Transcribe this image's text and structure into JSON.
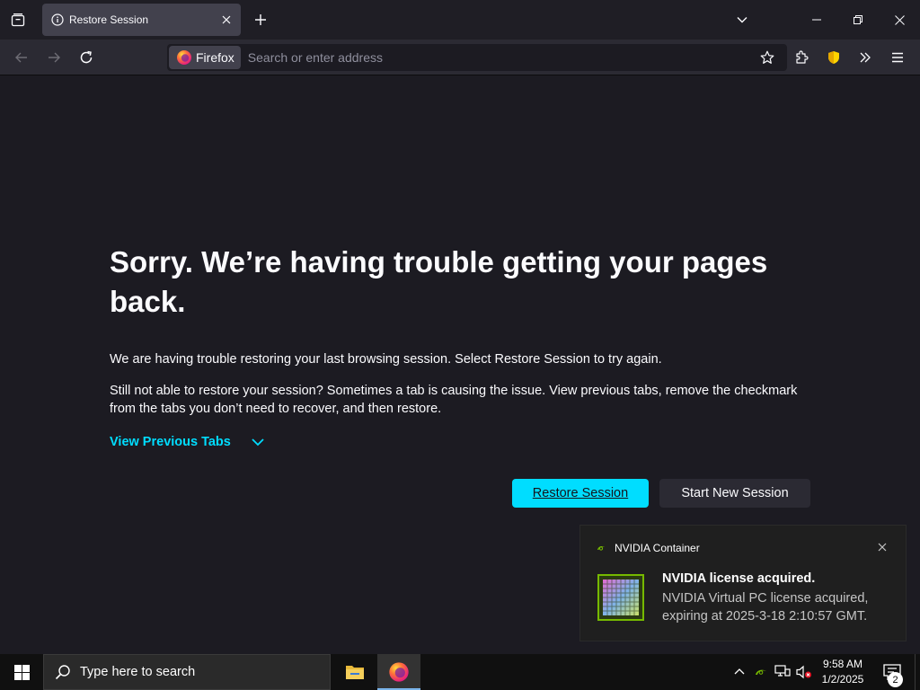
{
  "browser": {
    "tab": {
      "title": "Restore Session"
    },
    "identity_label": "Firefox",
    "urlbar_placeholder": "Search or enter address"
  },
  "page": {
    "title": "Sorry. We’re having trouble getting your pages back.",
    "paragraph1": "We are having trouble restoring your last browsing session. Select Restore Session to try again.",
    "paragraph2": "Still not able to restore your session? Sometimes a tab is causing the issue. View previous tabs, remove the checkmark from the tabs you don’t need to recover, and then restore.",
    "view_previous_tabs": "View Previous Tabs",
    "restore_button": "Restore Session",
    "new_session_button": "Start New Session"
  },
  "notification": {
    "app_name": "NVIDIA Container",
    "title": "NVIDIA license acquired.",
    "body": "NVIDIA Virtual PC license acquired, expiring at 2025-3-18 2:10:57 GMT."
  },
  "taskbar": {
    "search_placeholder": "Type here to search",
    "time": "9:58 AM",
    "date": "1/2/2025",
    "notification_count": "2"
  },
  "colors": {
    "accent": "#00ddff",
    "page_background": "#1c1b22",
    "nvidia_green": "#76b900"
  },
  "icons": [
    "tab-manager-icon",
    "info-icon",
    "close-icon",
    "plus-icon",
    "chevron-down-icon",
    "minimize-icon",
    "restore-icon",
    "back-icon",
    "forward-icon",
    "reload-icon",
    "firefox-icon",
    "star-icon",
    "extensions-icon",
    "shield-icon",
    "overflow-icon",
    "menu-icon",
    "windows-icon",
    "search-icon",
    "file-explorer-icon",
    "network-icon",
    "volume-muted-icon",
    "action-center-icon"
  ]
}
